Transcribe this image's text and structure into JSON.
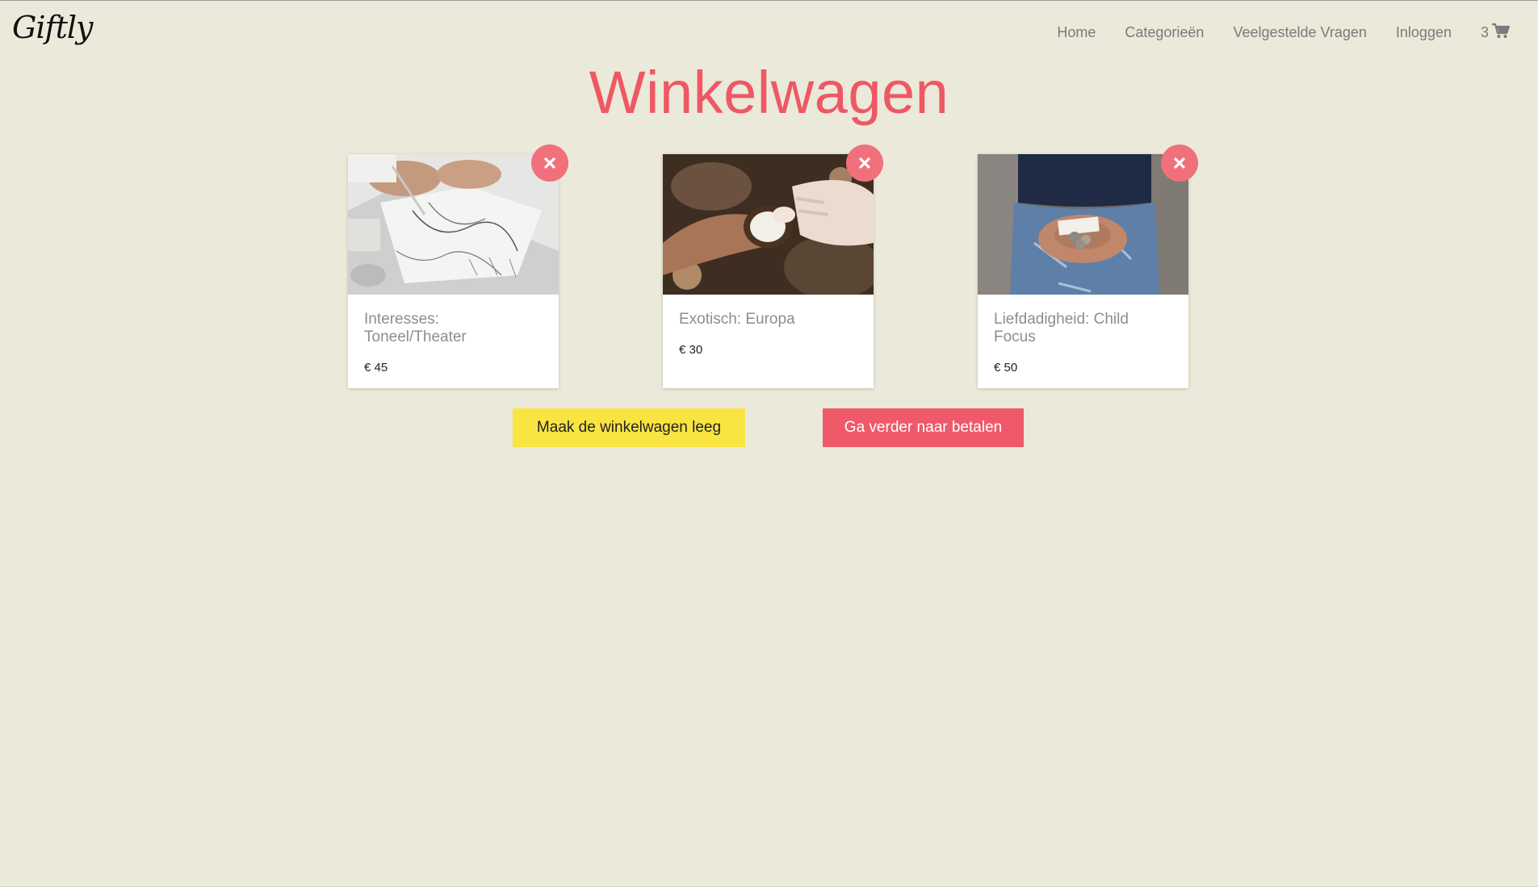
{
  "brand": {
    "logo_text": "Giftly"
  },
  "nav": {
    "items": [
      {
        "label": "Home"
      },
      {
        "label": "Categorieën"
      },
      {
        "label": "Veelgestelde Vragen"
      },
      {
        "label": "Inloggen"
      }
    ],
    "cart_count": "3",
    "cart_icon": "shopping-cart-icon"
  },
  "page": {
    "title": "Winkelwagen"
  },
  "cart_items": [
    {
      "title": "Interesses: Toneel/Theater",
      "price": "€ 45",
      "image": "sketching-hands-photo",
      "remove_icon": "close-icon"
    },
    {
      "title": "Exotisch: Europa",
      "price": "€ 30",
      "image": "coconut-hands-photo",
      "remove_icon": "close-icon"
    },
    {
      "title": "Liefdadigheid: Child Focus",
      "price": "€ 50",
      "image": "coins-in-hands-photo",
      "remove_icon": "close-icon"
    }
  ],
  "actions": {
    "empty_cart_label": "Maak de winkelwagen leeg",
    "checkout_label": "Ga verder naar betalen"
  },
  "colors": {
    "background": "#ebe9d9",
    "accent": "#ee5865",
    "remove_button": "#f0707c",
    "empty_button": "#f9e442",
    "checkout_button": "#f0596a"
  }
}
